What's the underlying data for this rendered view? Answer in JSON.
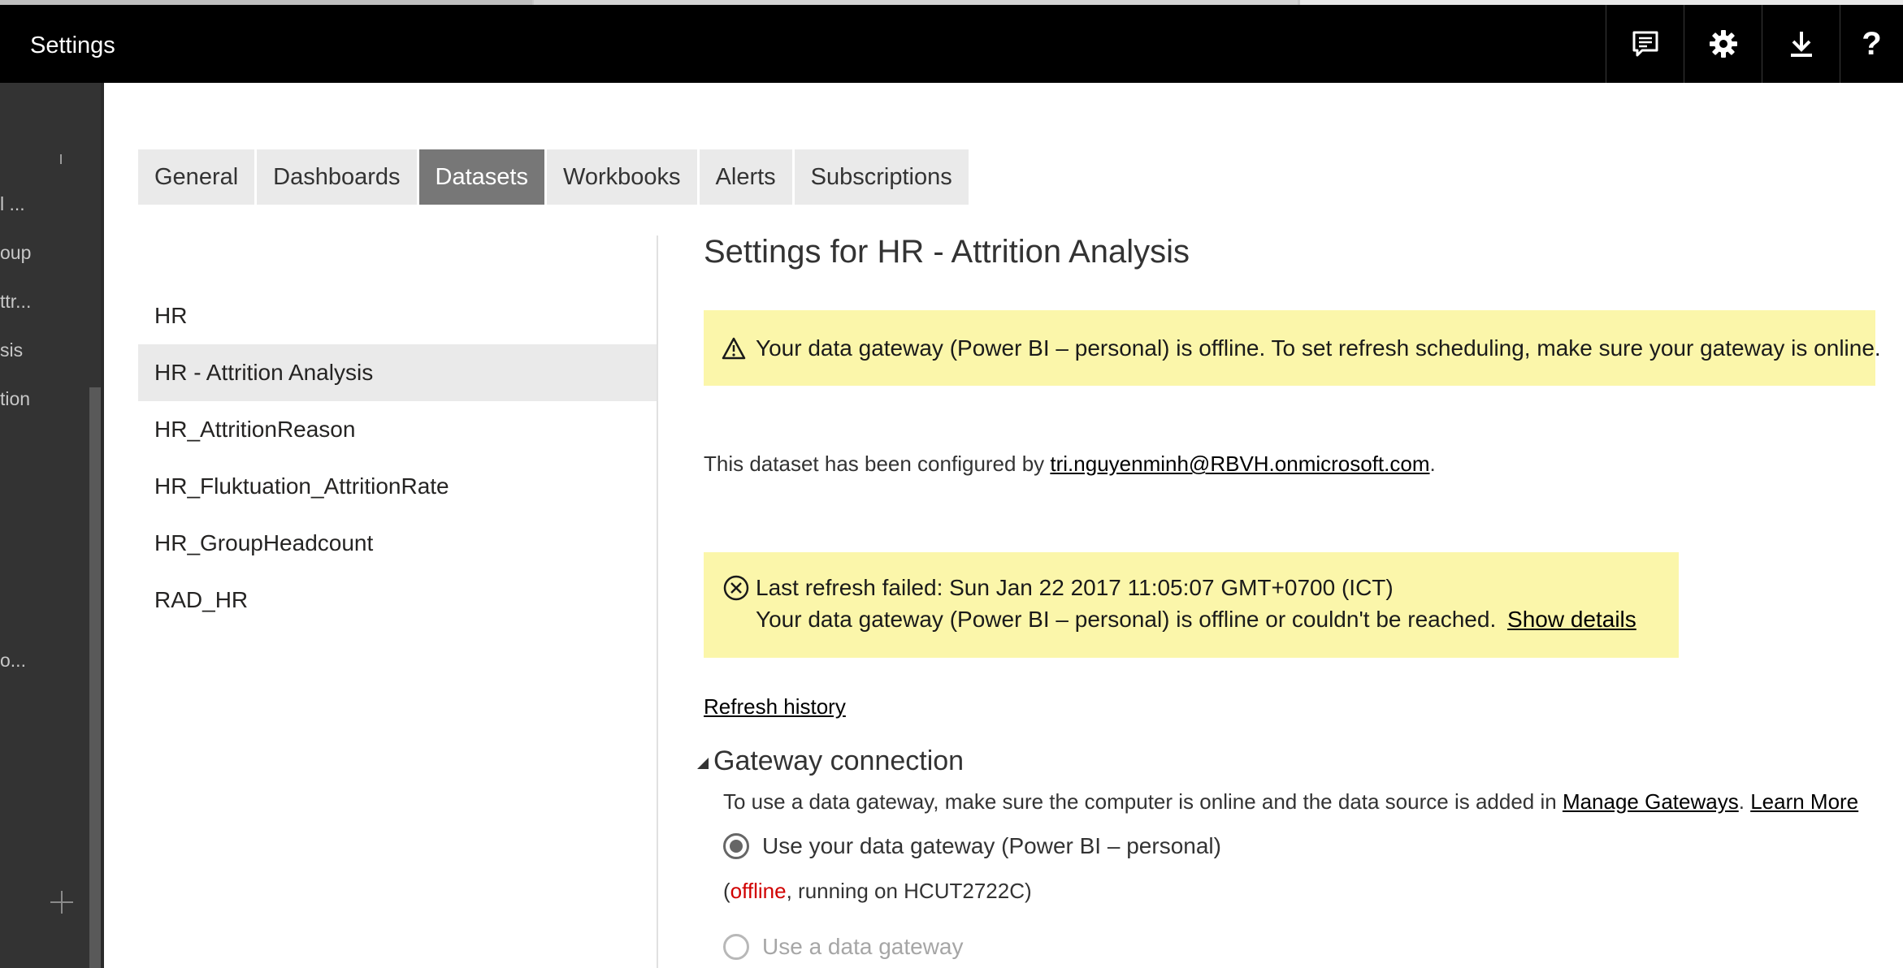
{
  "header": {
    "title": "Settings",
    "icons": [
      "feedback-icon",
      "gear-icon",
      "download-icon",
      "help-icon"
    ]
  },
  "leftnav": {
    "items": [
      "l ...",
      "oup",
      "ttr...",
      "sis",
      "tion",
      "o..."
    ]
  },
  "tabs": [
    {
      "label": "General",
      "active": false
    },
    {
      "label": "Dashboards",
      "active": false
    },
    {
      "label": "Datasets",
      "active": true
    },
    {
      "label": "Workbooks",
      "active": false
    },
    {
      "label": "Alerts",
      "active": false
    },
    {
      "label": "Subscriptions",
      "active": false
    }
  ],
  "datasets": {
    "items": [
      "HR",
      "HR - Attrition Analysis",
      "HR_AttritionReason",
      "HR_Fluktuation_AttritionRate",
      "HR_GroupHeadcount",
      "RAD_HR"
    ],
    "selected": "HR - Attrition Analysis"
  },
  "main": {
    "title": "Settings for HR - Attrition Analysis",
    "gateway_warning": "Your data gateway (Power BI – personal) is offline. To set refresh scheduling, make sure your gateway is online.",
    "configured_prefix": "This dataset has been configured by ",
    "configured_email": "tri.nguyenminh@RBVH.onmicrosoft.com",
    "configured_suffix": ".",
    "refresh_failed": "Last refresh failed: Sun Jan 22 2017 11:05:07 GMT+0700 (ICT)",
    "refresh_reason": "Your data gateway (Power BI – personal) is offline or couldn't be reached.",
    "show_details": "Show details",
    "refresh_history": "Refresh history",
    "gateway_section": {
      "title": "Gateway connection",
      "desc_prefix": "To use a data gateway, make sure the computer is online and the data source is added in ",
      "manage_gateways": "Manage Gateways",
      "desc_sep": ". ",
      "learn_more": "Learn More",
      "option_personal": "Use your data gateway (Power BI – personal)",
      "status_open": "(",
      "status_offline": "offline",
      "status_rest": ", running on HCUT2722C)",
      "option_gateway": "Use a data gateway"
    }
  },
  "colors": {
    "header_bg": "#000000",
    "warning_bg": "#fbf6aa",
    "tab_active_bg": "#777777",
    "offline_text": "#d10000"
  }
}
